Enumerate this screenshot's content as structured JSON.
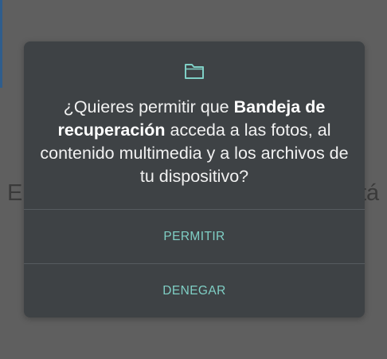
{
  "background": {
    "text_left": "El",
    "text_right": "tá"
  },
  "dialog": {
    "icon": "folder-icon",
    "message_prefix": "¿Quieres permitir que ",
    "app_name": "Bandeja de recuperación",
    "message_suffix": " acceda a las fotos, al contenido multimedia y a los archivos de tu dispositivo?",
    "allow_label": "PERMITIR",
    "deny_label": "DENEGAR"
  },
  "colors": {
    "scrim": "#5f5f5f",
    "dialog_bg": "#3e4245",
    "accent": "#7fcfc5",
    "text": "#f1f1f1"
  }
}
